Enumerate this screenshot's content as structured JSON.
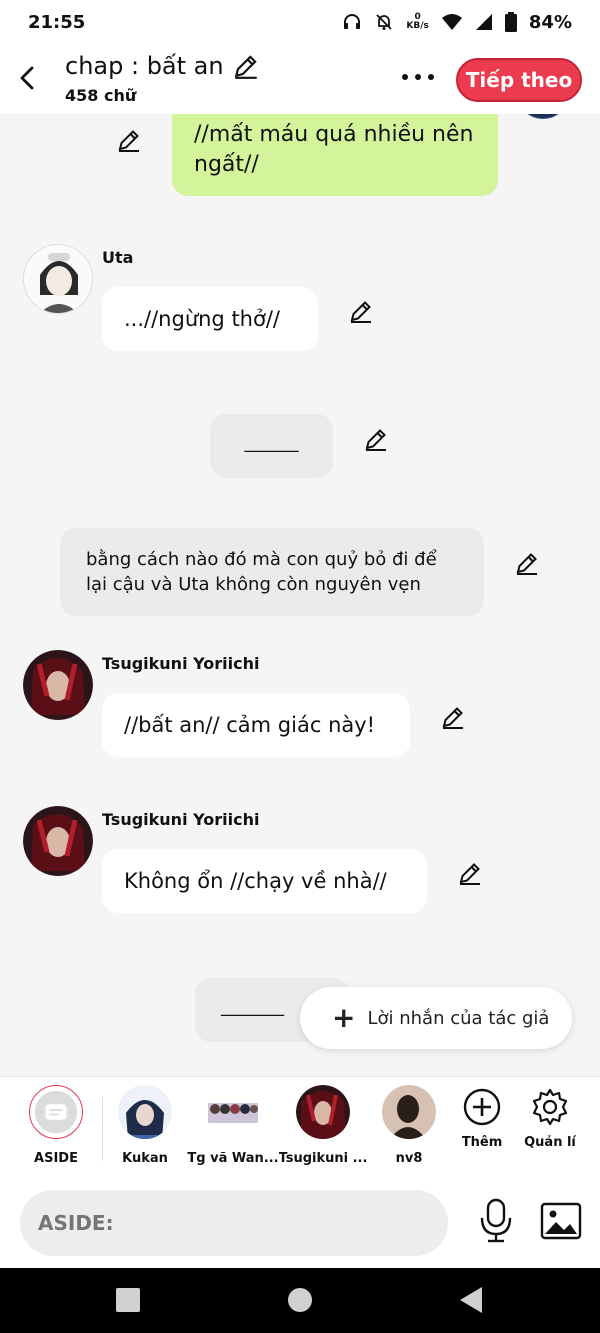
{
  "status": {
    "time": "21:55",
    "kbs_value": "0",
    "kbs_unit": "KB/s",
    "battery": "84%"
  },
  "header": {
    "title": "chap : bất an",
    "word_count": "458 chữ",
    "next_label": "Tiếp theo"
  },
  "messages": [
    {
      "text": "//mất máu quá nhiều nên ngất//"
    },
    {
      "speaker": "Uta",
      "text": "...//ngừng thở//"
    },
    {
      "text": "______"
    },
    {
      "text": "bằng cách nào đó mà con quỷ bỏ đi để lại cậu và Uta không còn nguyên vẹn"
    },
    {
      "speaker": "Tsugikuni Yoriichi",
      "text": "//bất an// cảm giác này!"
    },
    {
      "speaker": "Tsugikuni Yoriichi",
      "text": "Không ổn //chạy về nhà//"
    },
    {
      "text": "_______"
    }
  ],
  "author_note_label": "Lời nhắn của tác giả",
  "characters": [
    {
      "label": "ASIDE"
    },
    {
      "label": "Kukan"
    },
    {
      "label": "Tg vã Wan..."
    },
    {
      "label": "Tsugikuni ..."
    },
    {
      "label": "nv8"
    },
    {
      "label": "Thêm"
    },
    {
      "label": "Quản lí"
    }
  ],
  "input": {
    "placeholder": "ASIDE:"
  },
  "colors": {
    "accent": "#ec3b4f",
    "green_bubble": "#d4f49c",
    "grey_bubble": "#ebebeb"
  }
}
